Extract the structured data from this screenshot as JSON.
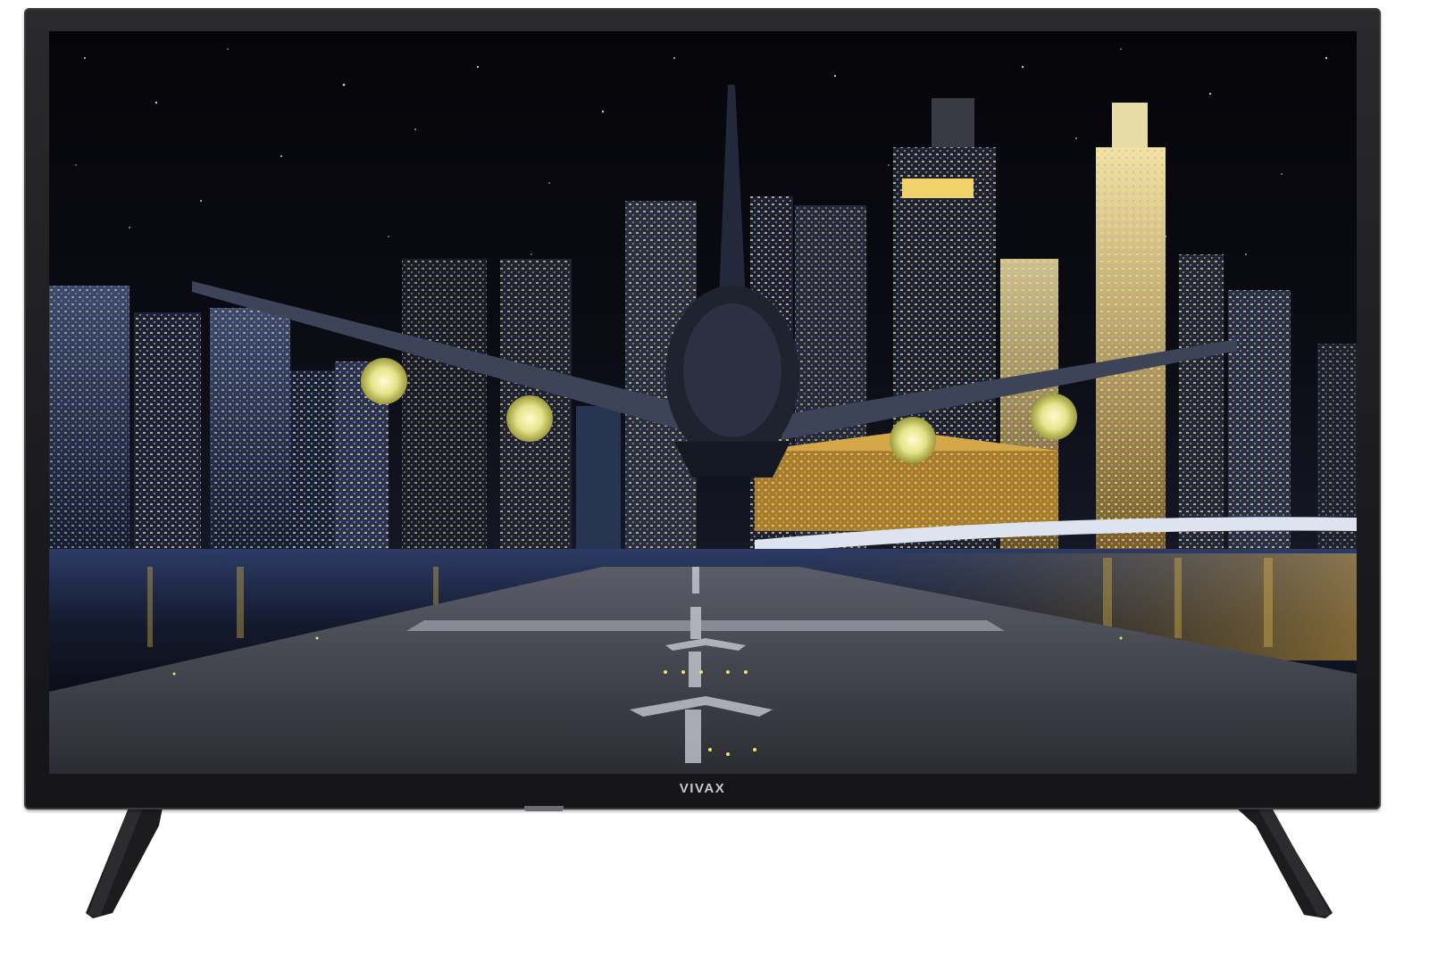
{
  "product": {
    "brand_logo": "VIVAX",
    "colors": {
      "bezel": "#1b1b1d",
      "stand": "#1a1a1c",
      "sky": "#06070c",
      "city_gold": "#e7b85a",
      "runway": "#4a4c55"
    }
  }
}
